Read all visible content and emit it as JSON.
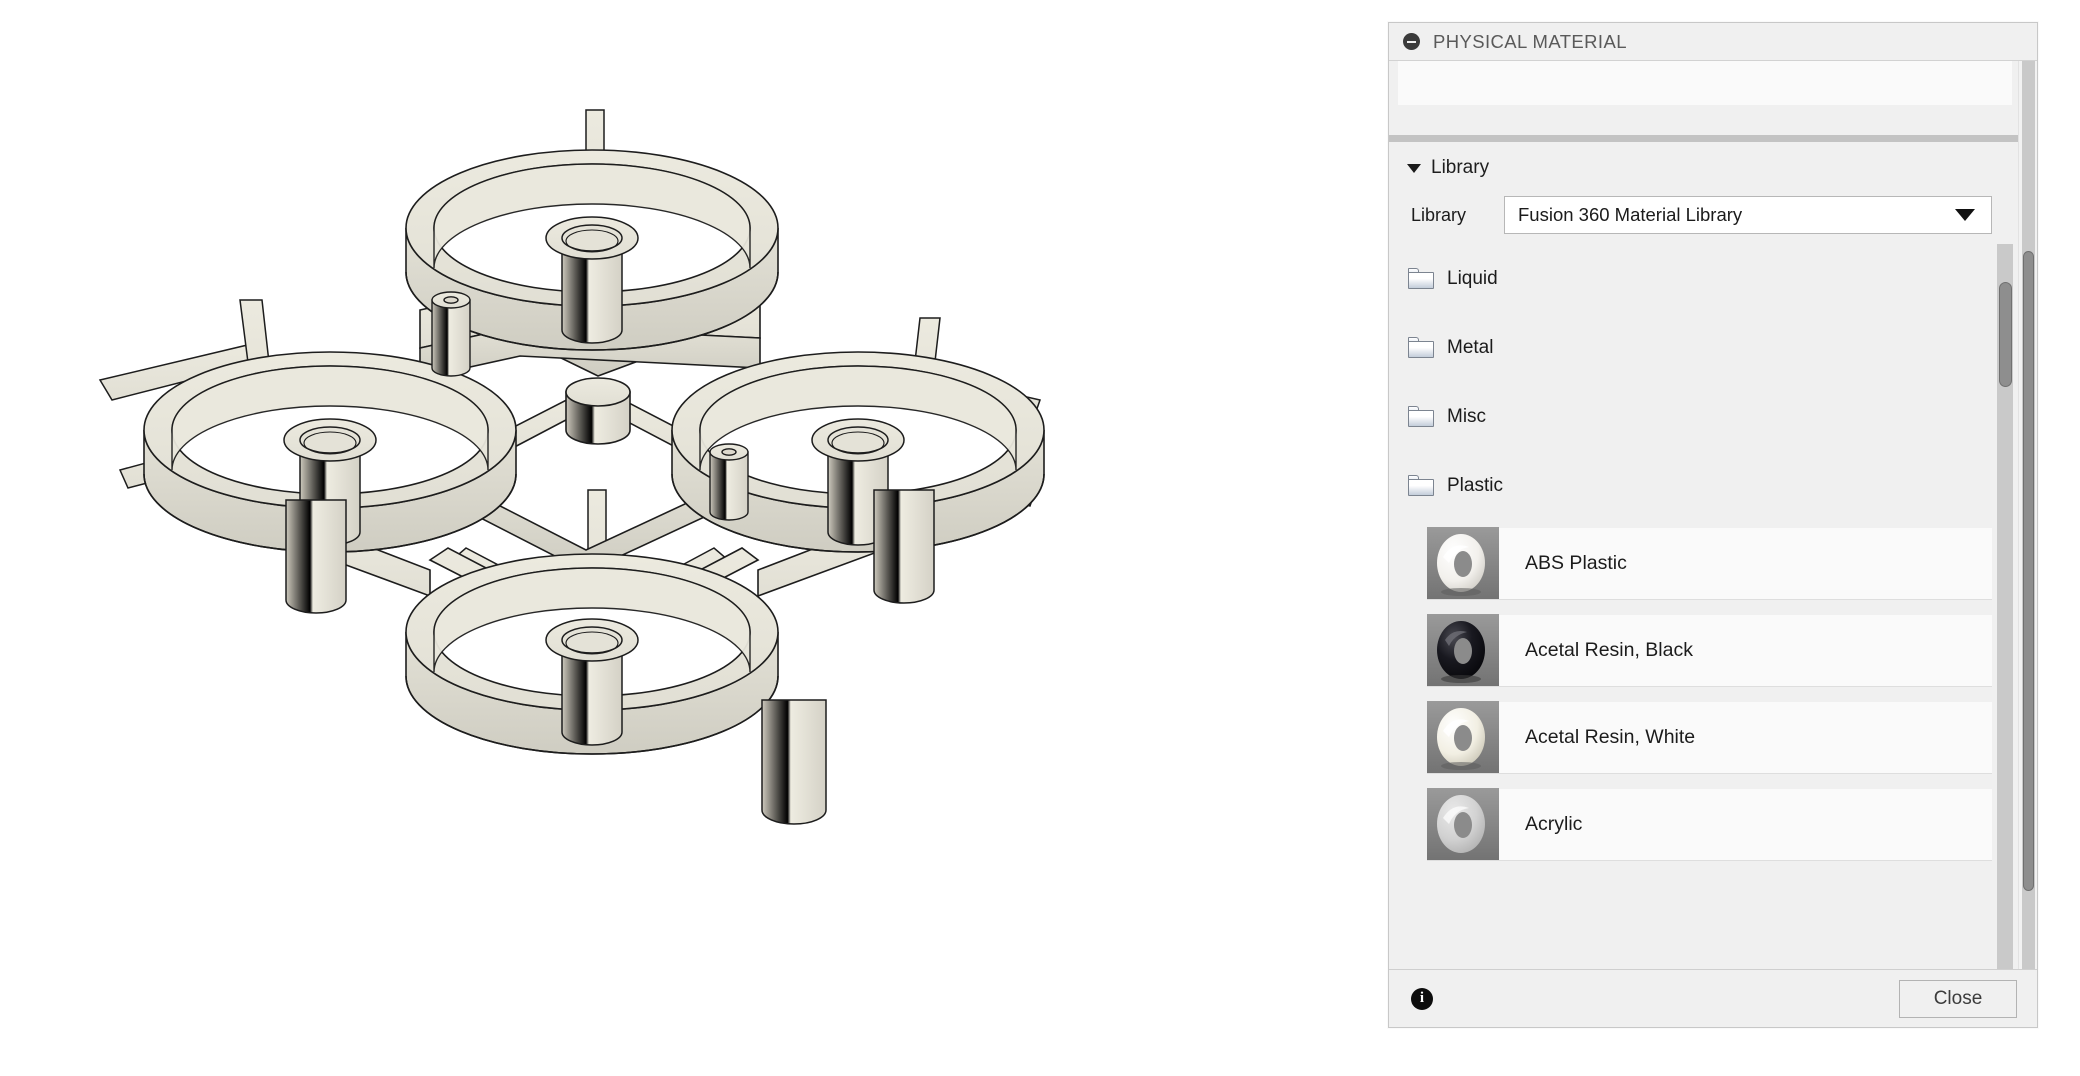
{
  "viewport": {
    "model_name": "quadcopter-frame",
    "background_color": "#ffffff",
    "body_fill": "#e8e6dd",
    "body_fill_shade": "#dbd9cf",
    "body_fill_dark": "#cfccc2",
    "edge_color": "#1d1d1d"
  },
  "panel": {
    "title": "PHYSICAL MATERIAL",
    "collapse_icon": "minus-circle-icon",
    "search_value": "",
    "search_placeholder": "",
    "library_section": {
      "expand_icon": "triangle-down-icon",
      "header_label": "Library",
      "field_label": "Library",
      "selected_library": "Fusion 360 Material Library",
      "caret_icon": "chevron-down-icon"
    },
    "folders": [
      {
        "icon": "folder-icon",
        "label": "Liquid"
      },
      {
        "icon": "folder-icon",
        "label": "Metal"
      },
      {
        "icon": "folder-icon",
        "label": "Misc"
      },
      {
        "icon": "folder-icon",
        "label": "Plastic"
      }
    ],
    "materials": [
      {
        "name": "ABS Plastic",
        "swatch": "#f4f2ee",
        "swatch_shadow": "#c9c6bf",
        "thumb_bg": "#8d8d8d"
      },
      {
        "name": "Acetal Resin, Black",
        "swatch": "#15151a",
        "swatch_shadow": "#050507",
        "thumb_bg": "#8d8d8d"
      },
      {
        "name": "Acetal Resin, White",
        "swatch": "#f3efe2",
        "swatch_shadow": "#c5c0ae",
        "thumb_bg": "#8d8d8d"
      },
      {
        "name": "Acrylic",
        "swatch": "#dedede",
        "swatch_shadow": "#b4b4b4",
        "thumb_bg": "#8d8d8d"
      }
    ],
    "footer": {
      "info_icon": "info-icon",
      "info_glyph": "i",
      "close_label": "Close"
    },
    "scrollbars": {
      "outer": "panel-vertical-scrollbar",
      "inner": "material-list-vertical-scrollbar"
    }
  }
}
